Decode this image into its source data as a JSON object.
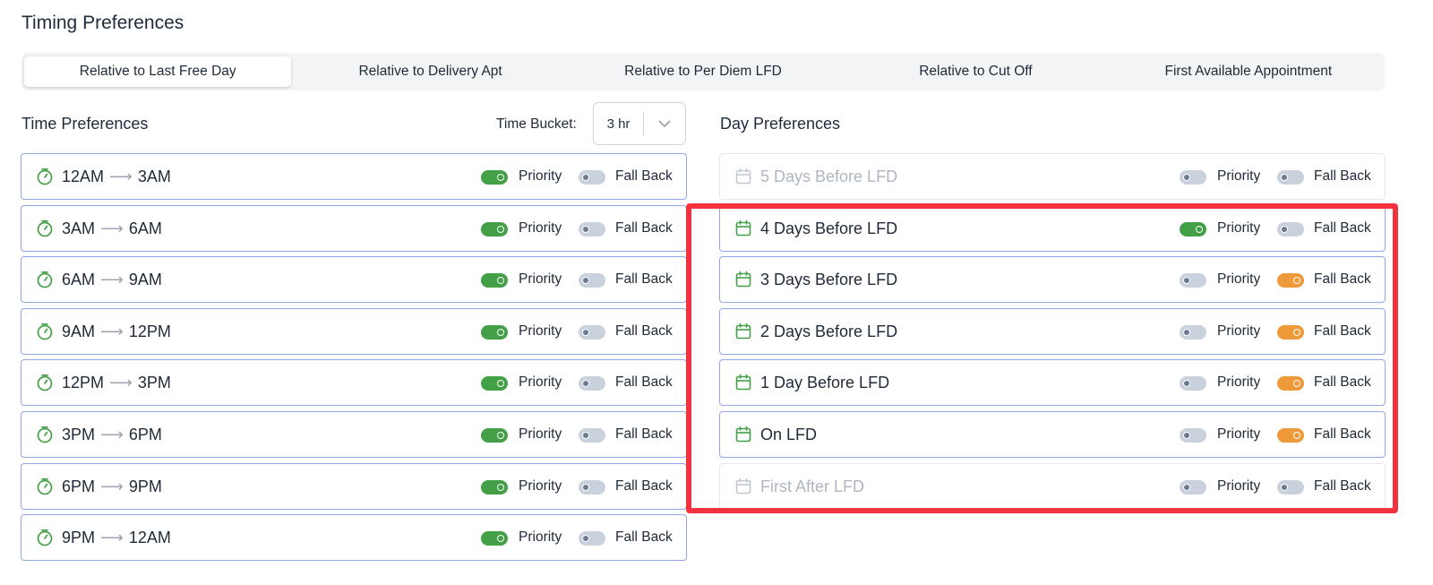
{
  "page": {
    "title": "Timing Preferences"
  },
  "tabs": [
    {
      "label": "Relative to Last Free Day",
      "active": true
    },
    {
      "label": "Relative to Delivery Apt",
      "active": false
    },
    {
      "label": "Relative to Per Diem LFD",
      "active": false
    },
    {
      "label": "Relative to Cut Off",
      "active": false
    },
    {
      "label": "First Available Appointment",
      "active": false
    }
  ],
  "time_prefs": {
    "title": "Time Preferences",
    "bucket_label": "Time Bucket:",
    "bucket_value": "3 hr",
    "priority_label": "Priority",
    "fallback_label": "Fall Back",
    "rows": [
      {
        "from": "12AM",
        "to": "3AM",
        "priority": true,
        "fallback": false
      },
      {
        "from": "3AM",
        "to": "6AM",
        "priority": true,
        "fallback": false
      },
      {
        "from": "6AM",
        "to": "9AM",
        "priority": true,
        "fallback": false
      },
      {
        "from": "9AM",
        "to": "12PM",
        "priority": true,
        "fallback": false
      },
      {
        "from": "12PM",
        "to": "3PM",
        "priority": true,
        "fallback": false
      },
      {
        "from": "3PM",
        "to": "6PM",
        "priority": true,
        "fallback": false
      },
      {
        "from": "6PM",
        "to": "9PM",
        "priority": true,
        "fallback": false
      },
      {
        "from": "9PM",
        "to": "12AM",
        "priority": true,
        "fallback": false
      }
    ]
  },
  "day_prefs": {
    "title": "Day Preferences",
    "priority_label": "Priority",
    "fallback_label": "Fall Back",
    "rows": [
      {
        "label": "5 Days Before LFD",
        "enabled": false,
        "priority": false,
        "fallback": false
      },
      {
        "label": "4 Days Before LFD",
        "enabled": true,
        "priority": true,
        "fallback": false
      },
      {
        "label": "3 Days Before LFD",
        "enabled": true,
        "priority": false,
        "fallback": true
      },
      {
        "label": "2 Days Before LFD",
        "enabled": true,
        "priority": false,
        "fallback": true
      },
      {
        "label": "1 Day Before LFD",
        "enabled": true,
        "priority": false,
        "fallback": true
      },
      {
        "label": "On LFD",
        "enabled": true,
        "priority": false,
        "fallback": true
      },
      {
        "label": "First After LFD",
        "enabled": false,
        "priority": false,
        "fallback": false
      }
    ]
  },
  "colors": {
    "priority_on": "#43a047",
    "fallback_on": "#ee9a3a",
    "toggle_off": "#c9d1dc",
    "row_border": "#8fa6e8",
    "highlight": "#f2323f"
  },
  "icons": {
    "time_row": "stopwatch-icon",
    "day_row": "calendar-icon",
    "bucket": "chevron-down-icon"
  }
}
